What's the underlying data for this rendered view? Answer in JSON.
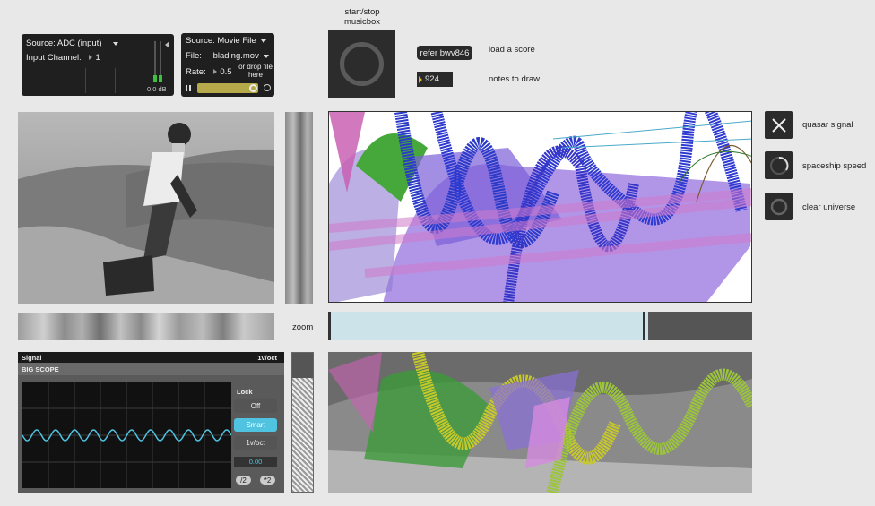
{
  "adc_panel": {
    "source_label": "Source: ADC (input)",
    "channel_label": "Input Channel:",
    "channel_value": "1",
    "meter_db": "0.0 dB"
  },
  "movie_panel": {
    "source_label": "Source: Movie File",
    "file_label": "File:",
    "file_value": "blading.mov",
    "rate_label": "Rate:",
    "rate_value": "0.5",
    "drop_hint": "or drop file here"
  },
  "musicbox": {
    "label": "start/stop musicbox"
  },
  "score": {
    "button_label": "refer bwv846",
    "load_label": "load a score",
    "notes_value": "924",
    "notes_label": "notes to draw"
  },
  "controls": {
    "quasar_label": "quasar signal",
    "spaceship_label": "spaceship speed",
    "clear_label": "clear universe"
  },
  "zoom_label": "zoom",
  "scope": {
    "header_left": "Signal",
    "header_right": "1v/oct",
    "title": "BIG SCOPE",
    "lock_label": "Lock",
    "btn_off": "Off",
    "btn_smart": "Smart",
    "btn_1voct": "1v/oct",
    "value": "0.00",
    "div_btn": "/2",
    "mul_btn": "*2"
  },
  "colors": {
    "accent_cyan": "#4fc3e0",
    "meter_green": "#3ec13e",
    "zoom_bar": "#cde3ea"
  }
}
